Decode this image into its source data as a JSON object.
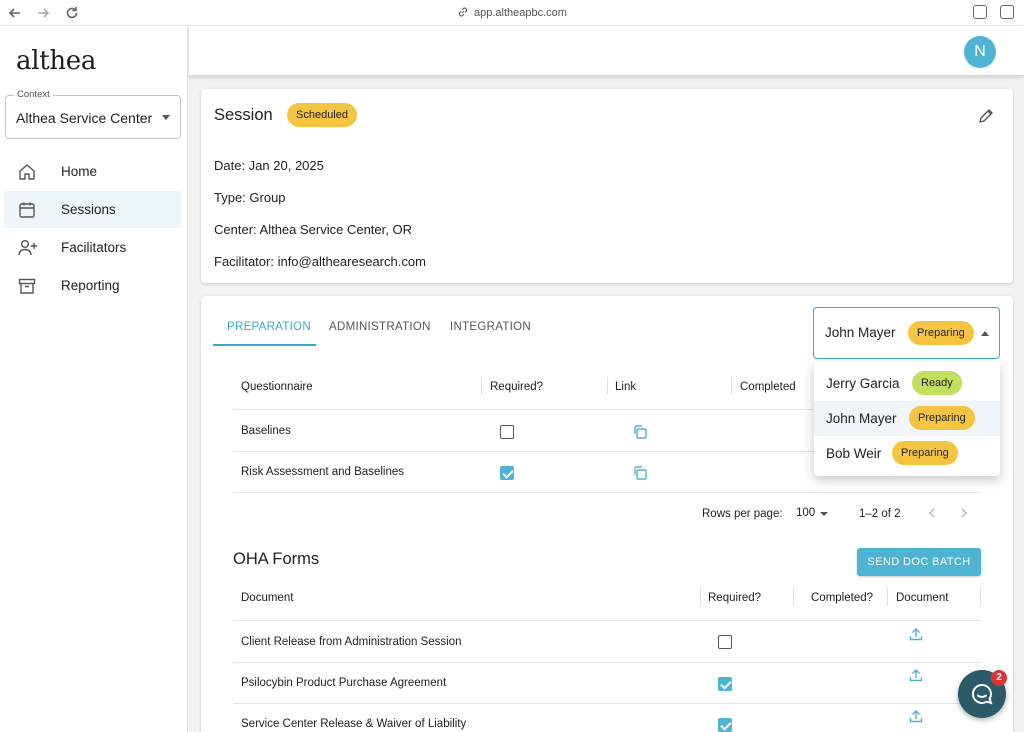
{
  "browser": {
    "url": "app.altheapbc.com"
  },
  "sidebar": {
    "logo": "althea",
    "context": {
      "label": "Context",
      "value": "Althea Service Center"
    },
    "items": [
      {
        "label": "Home",
        "icon": "home-icon",
        "active": false
      },
      {
        "label": "Sessions",
        "icon": "calendar-icon",
        "active": true
      },
      {
        "label": "Facilitators",
        "icon": "person-add-icon",
        "active": false
      },
      {
        "label": "Reporting",
        "icon": "archive-icon",
        "active": false
      }
    ]
  },
  "header": {
    "avatar_initial": "N"
  },
  "session": {
    "title": "Session",
    "status": "Scheduled",
    "date": "Date: Jan 20, 2025",
    "type": "Type: Group",
    "center": "Center: Althea Service Center, OR",
    "facilitator": "Facilitator: info@althearesearch.com"
  },
  "tabs": [
    "PREPARATION",
    "ADMINISTRATION",
    "INTEGRATION"
  ],
  "person_select": {
    "name": "John Mayer",
    "status": "Preparing"
  },
  "person_menu": [
    {
      "name": "Jerry Garcia",
      "status": "Ready"
    },
    {
      "name": "John Mayer",
      "status": "Preparing"
    },
    {
      "name": "Bob Weir",
      "status": "Preparing"
    }
  ],
  "questionnaires": {
    "headers": [
      "Questionnaire",
      "Required?",
      "Link",
      "Completed"
    ],
    "rows": [
      {
        "name": "Baselines",
        "required": false
      },
      {
        "name": "Risk Assessment and Baselines",
        "required": true
      }
    ],
    "pagination": {
      "rows_per_page_label": "Rows per page:",
      "rows_per_page": "100",
      "range": "1–2 of 2"
    }
  },
  "oha_forms": {
    "title": "OHA Forms",
    "send_button": "SEND DOC BATCH",
    "headers": [
      "Document",
      "Required?",
      "Completed?",
      "Document"
    ],
    "rows": [
      {
        "name": "Client Release from Administration Session",
        "required": false
      },
      {
        "name": "Psilocybin Product Purchase Agreement",
        "required": true
      },
      {
        "name": "Service Center Release & Waiver of Liability",
        "required": true
      }
    ]
  },
  "chat": {
    "unread": "2"
  },
  "colors": {
    "accent": "#4fb3d4",
    "badge_yellow": "#f5c542",
    "badge_green": "#c3df5e"
  }
}
